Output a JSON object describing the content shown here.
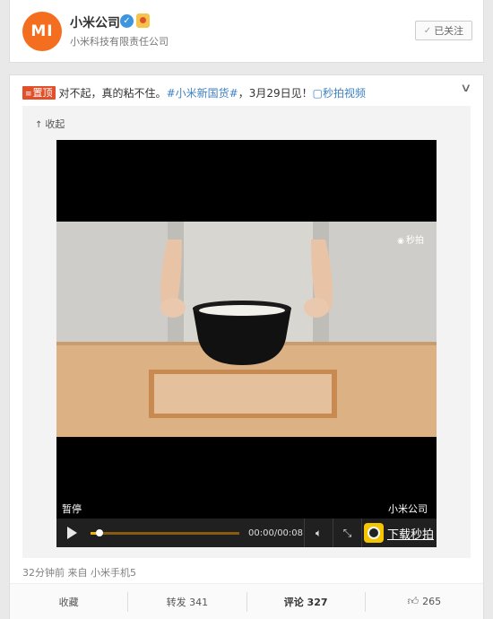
{
  "header": {
    "avatar_text": "MI",
    "name": "小米公司",
    "verified_icon": "verified-badge-icon",
    "description": "小米科技有限责任公司",
    "follow_label": "已关注"
  },
  "post": {
    "top_badge": "置顶",
    "text_before": "对不起，真的粘不住。",
    "hashtag": "#小米新国货#",
    "text_after": "，3月29日见！",
    "video_link": "秒拍视频",
    "collapse_label": "收起",
    "meta": "32分钟前 来自 小米手机5"
  },
  "video": {
    "watermark": "秒拍",
    "pause_label": "暂停",
    "source_label": "小米公司",
    "time": "00:00/00:08",
    "progress": 0.06,
    "download_label": "下载秒拍"
  },
  "actions": {
    "favorite": "收藏",
    "repost": "转发 341",
    "comment": "评论 327",
    "like_count": "265"
  },
  "colors": {
    "brand_orange": "#f36e1f",
    "link_blue": "#3e82c4",
    "badge_red": "#e2502b",
    "progress_gold": "#f0b400"
  }
}
